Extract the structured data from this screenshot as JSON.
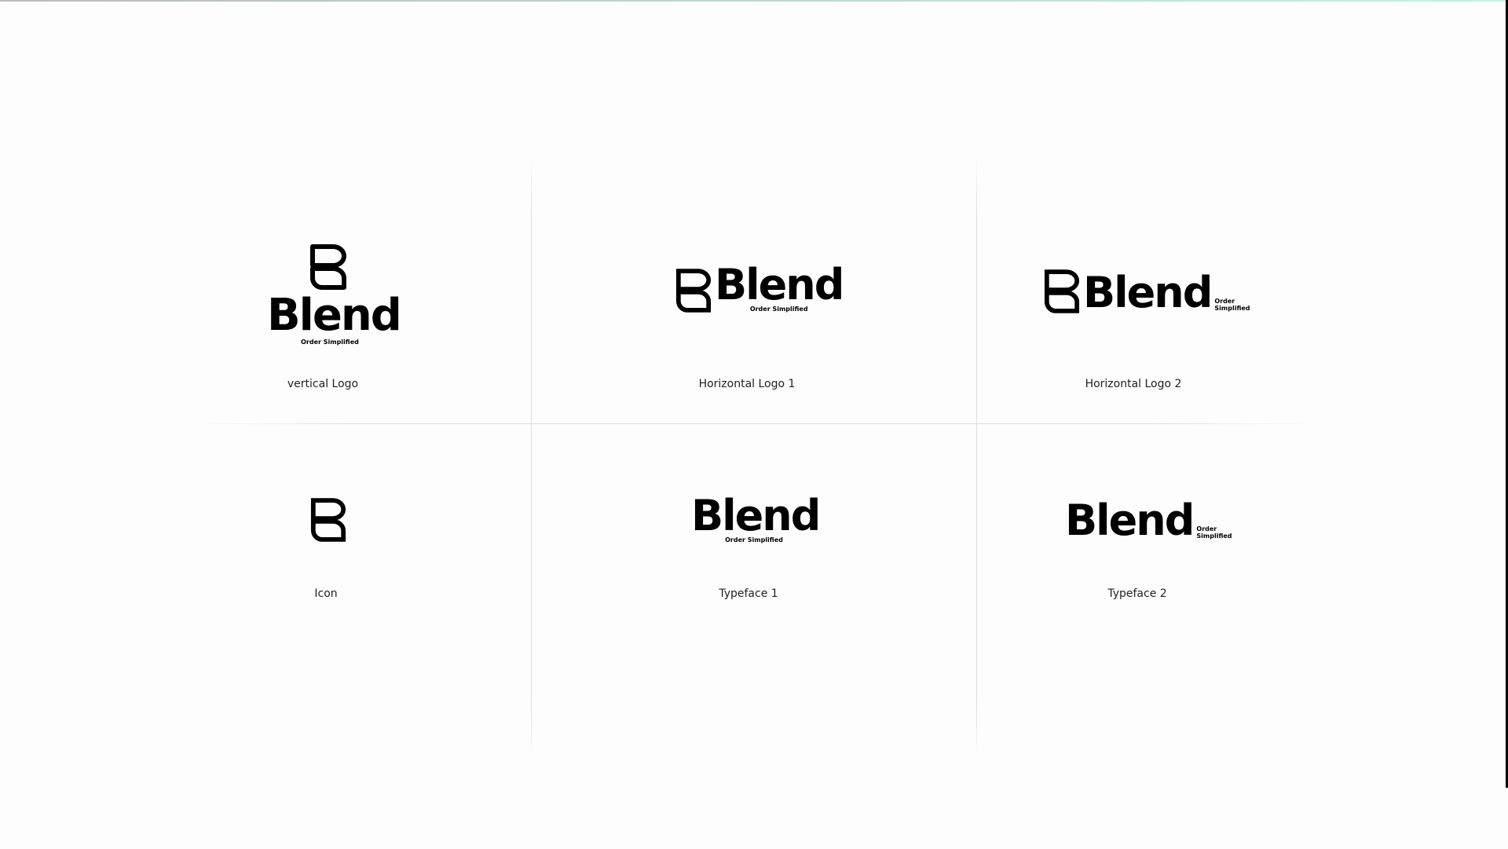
{
  "brand": {
    "name": "Blend",
    "tagline": "Order Simplified",
    "tagline_line1": "Order",
    "tagline_line2": "Simplified",
    "icon": "blend-stacked-icon"
  },
  "variants": [
    {
      "label": "vertical Logo"
    },
    {
      "label": "Horizontal Logo 1"
    },
    {
      "label": "Horizontal Logo 2"
    },
    {
      "label": "Icon"
    },
    {
      "label": "Typeface 1"
    },
    {
      "label": "Typeface 2"
    }
  ],
  "colors": {
    "background": "#fdfdfd",
    "logo": "#000000",
    "divider": "#dddddd"
  }
}
